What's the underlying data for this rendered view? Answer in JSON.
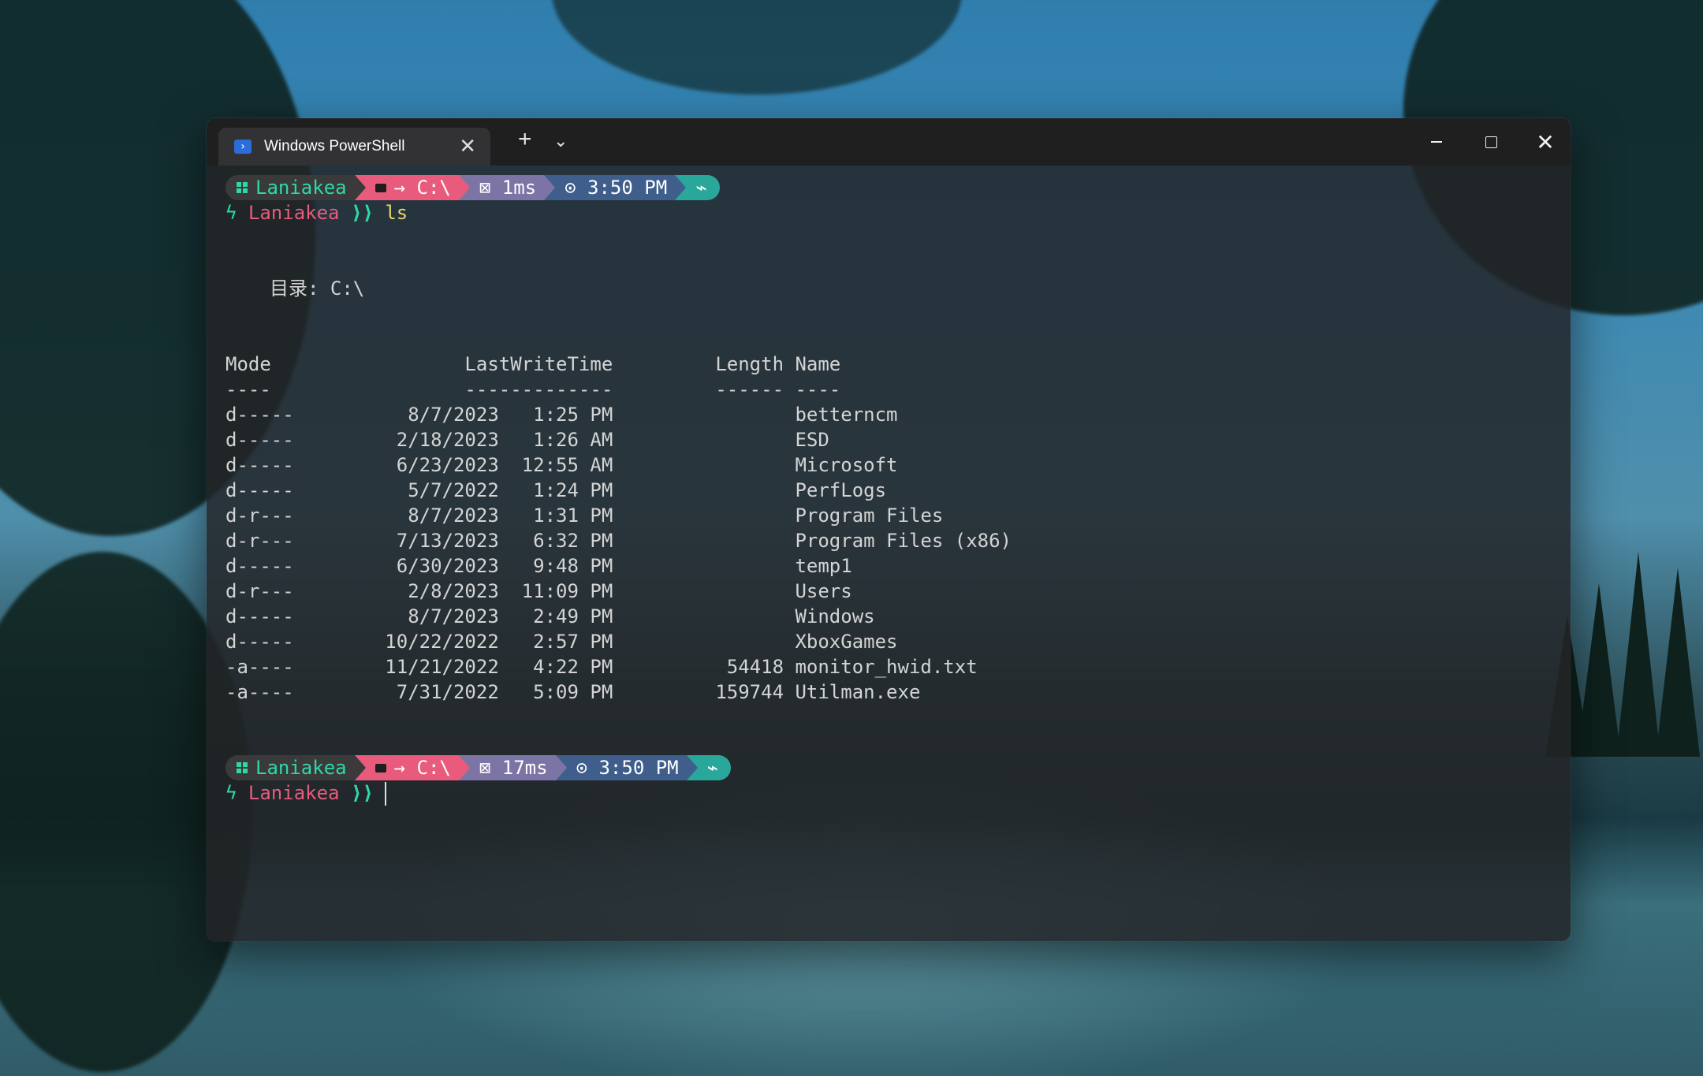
{
  "window": {
    "tab_title": "Windows PowerShell",
    "tab_icon": "powershell-icon",
    "new_tab": "+",
    "dropdown": "⌄",
    "minimize": "—",
    "maximize": "☐",
    "close": "✕"
  },
  "prompt1": {
    "user": "Laniakea",
    "path_arrow": "→",
    "path": "C:\\",
    "exec_time": "1ms",
    "clock": "3:50 PM",
    "end_icon": "⌁",
    "shell_user": "Laniakea",
    "chevrons": "⟩⟩",
    "command": "ls"
  },
  "output": {
    "directory_line": "目录: C:\\",
    "header": "Mode                 LastWriteTime         Length Name",
    "separator": "----                 -------------         ------ ----",
    "rows": [
      "d-----          8/7/2023   1:25 PM                betterncm",
      "d-----         2/18/2023   1:26 AM                ESD",
      "d-----         6/23/2023  12:55 AM                Microsoft",
      "d-----          5/7/2022   1:24 PM                PerfLogs",
      "d-r---          8/7/2023   1:31 PM                Program Files",
      "d-r---         7/13/2023   6:32 PM                Program Files (x86)",
      "d-----         6/30/2023   9:48 PM                temp1",
      "d-r---          2/8/2023  11:09 PM                Users",
      "d-----          8/7/2023   2:49 PM                Windows",
      "d-----        10/22/2022   2:57 PM                XboxGames",
      "-a----        11/21/2022   4:22 PM          54418 monitor_hwid.txt",
      "-a----         7/31/2022   5:09 PM         159744 Utilman.exe"
    ]
  },
  "prompt2": {
    "user": "Laniakea",
    "path_arrow": "→",
    "path": "C:\\",
    "exec_time": "17ms",
    "clock": "3:50 PM",
    "end_icon": "⌁",
    "shell_user": "Laniakea",
    "chevrons": "⟩⟩"
  },
  "colors": {
    "user_segment": "#3a3a3a",
    "path_segment": "#e85b7d",
    "exec_segment": "#7d74a6",
    "time_segment": "#3f5e8c",
    "end_segment": "#2aa79b",
    "accent_green": "#2ed8a8",
    "command_yellow": "#e8d46a"
  }
}
